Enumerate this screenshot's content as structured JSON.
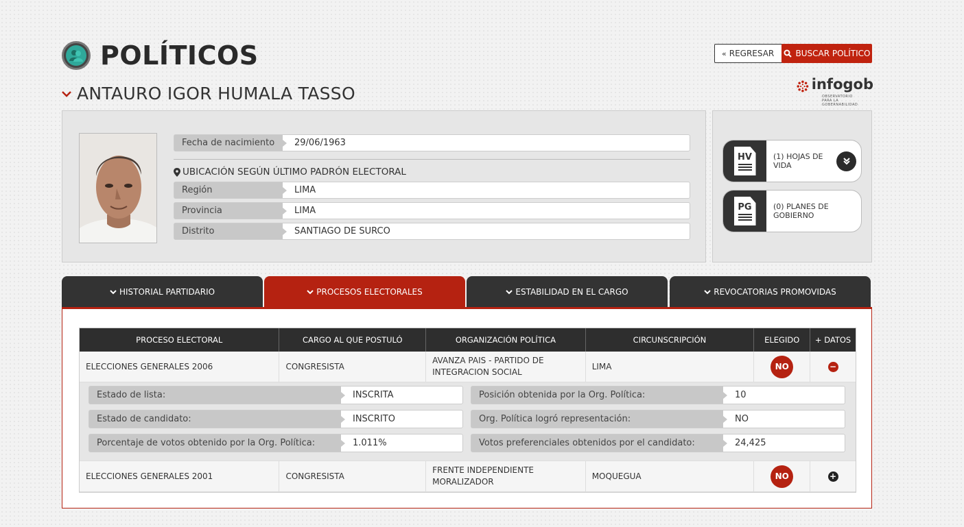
{
  "header": {
    "title": "POLÍTICOS",
    "back_label": "REGRESAR",
    "search_label": "BUSCAR POLÍTICO",
    "logo_word": "infogob",
    "logo_sub_1": "OBSERVATORIO",
    "logo_sub_2": "PARA LA GOBERNABILIDAD",
    "brand_color": "#b52211"
  },
  "person": {
    "name": "ANTAURO IGOR HUMALA TASSO",
    "birth_label": "Fecha de nacimiento",
    "birth_value": "29/06/1963",
    "location_heading": "UBICACIÓN SEGÚN ÚLTIMO PADRÓN ELECTORAL",
    "region_label": "Región",
    "region_value": "LIMA",
    "provincia_label": "Provincia",
    "provincia_value": "LIMA",
    "distrito_label": "Distrito",
    "distrito_value": "SANTIAGO DE SURCO"
  },
  "documents": {
    "hv_icon": "HV",
    "hv_label": "(1) HOJAS DE VIDA",
    "pg_icon": "PG",
    "pg_label": "(0) PLANES DE GOBIERNO"
  },
  "tabs": [
    {
      "label": "HISTORIAL PARTIDARIO"
    },
    {
      "label": "PROCESOS ELECTORALES"
    },
    {
      "label": "ESTABILIDAD EN EL CARGO"
    },
    {
      "label": "REVOCATORIAS PROMOVIDAS"
    }
  ],
  "table": {
    "headers": [
      "PROCESO ELECTORAL",
      "CARGO AL QUE POSTULÓ",
      "ORGANIZACIÓN POLÍTICA",
      "CIRCUNSCRIPCIÓN",
      "ELEGIDO",
      "+ DATOS"
    ],
    "rows": [
      {
        "proceso": "ELECCIONES GENERALES 2006",
        "cargo": "CONGRESISTA",
        "organizacion": "AVANZA PAIS - PARTIDO DE INTEGRACION SOCIAL",
        "circunscripcion": "LIMA",
        "elegido": "NO",
        "toggle": "−"
      },
      {
        "proceso": "ELECCIONES GENERALES 2001",
        "cargo": "CONGRESISTA",
        "organizacion": "FRENTE INDEPENDIENTE MORALIZADOR",
        "circunscripcion": "MOQUEGUA",
        "elegido": "NO",
        "toggle": "+"
      }
    ],
    "details": {
      "estado_lista_label": "Estado de lista:",
      "estado_lista_value": "INSCRITA",
      "estado_candidato_label": "Estado de candidato:",
      "estado_candidato_value": "INSCRITO",
      "porcentaje_label": "Porcentaje de votos obtenido por la Org. Política:",
      "porcentaje_value": "1.011%",
      "posicion_label": "Posición obtenida por la Org. Política:",
      "posicion_value": "10",
      "representacion_label": "Org. Política logró representación:",
      "representacion_value": "NO",
      "preferenciales_label": "Votos preferenciales obtenidos por el candidato:",
      "preferenciales_value": "24,425"
    }
  }
}
